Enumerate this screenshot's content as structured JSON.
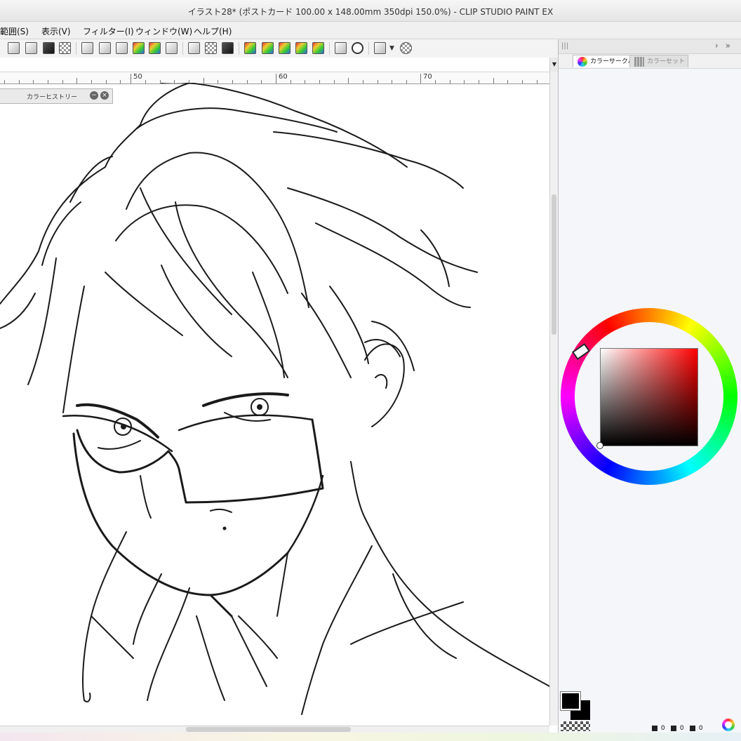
{
  "window": {
    "title": "イラスト28* (ポストカード 100.00 x 148.00mm 350dpi 150.0%)  - CLIP STUDIO PAINT EX"
  },
  "menu": [
    {
      "label": "範囲(S)"
    },
    {
      "label": "表示(V)"
    },
    {
      "label": "フィルター(I)"
    },
    {
      "label": "ウィンドウ(W)"
    },
    {
      "label": "ヘルプ(H)"
    }
  ],
  "toolbar_icons": [
    "transform-icon",
    "select-icon",
    "pen-tool-icon",
    "dotted-select-icon",
    "fill-icon",
    "layer-icon",
    "crop-icon",
    "text-tool-icon",
    "adjust-icon",
    "gradient-icon",
    "brush-icon",
    "checker-icon",
    "arrow-icon",
    "list-icon",
    "swatch-icon",
    "color-grid-icon",
    "layer-stack-icon",
    "film-icon",
    "camera-icon",
    "search-icon",
    "monitor-icon",
    "dots-icon"
  ],
  "ruler": {
    "labels": [
      "50",
      "60",
      "70"
    ]
  },
  "canvas": {
    "line_color": "#1a1a1a",
    "background": "#ffffff"
  },
  "color_history_panel": {
    "title": "カラーヒストリー"
  },
  "right_panel": {
    "tabs": [
      {
        "label": "カラーサークル",
        "active": true
      },
      {
        "label": "カラーセット",
        "active": false
      }
    ],
    "color_circle": {
      "hue_color": "#ff0000",
      "main_color": "#000000",
      "sub_color": "#000000"
    },
    "hsv": {
      "h": "0",
      "s": "0",
      "v": "0"
    }
  }
}
